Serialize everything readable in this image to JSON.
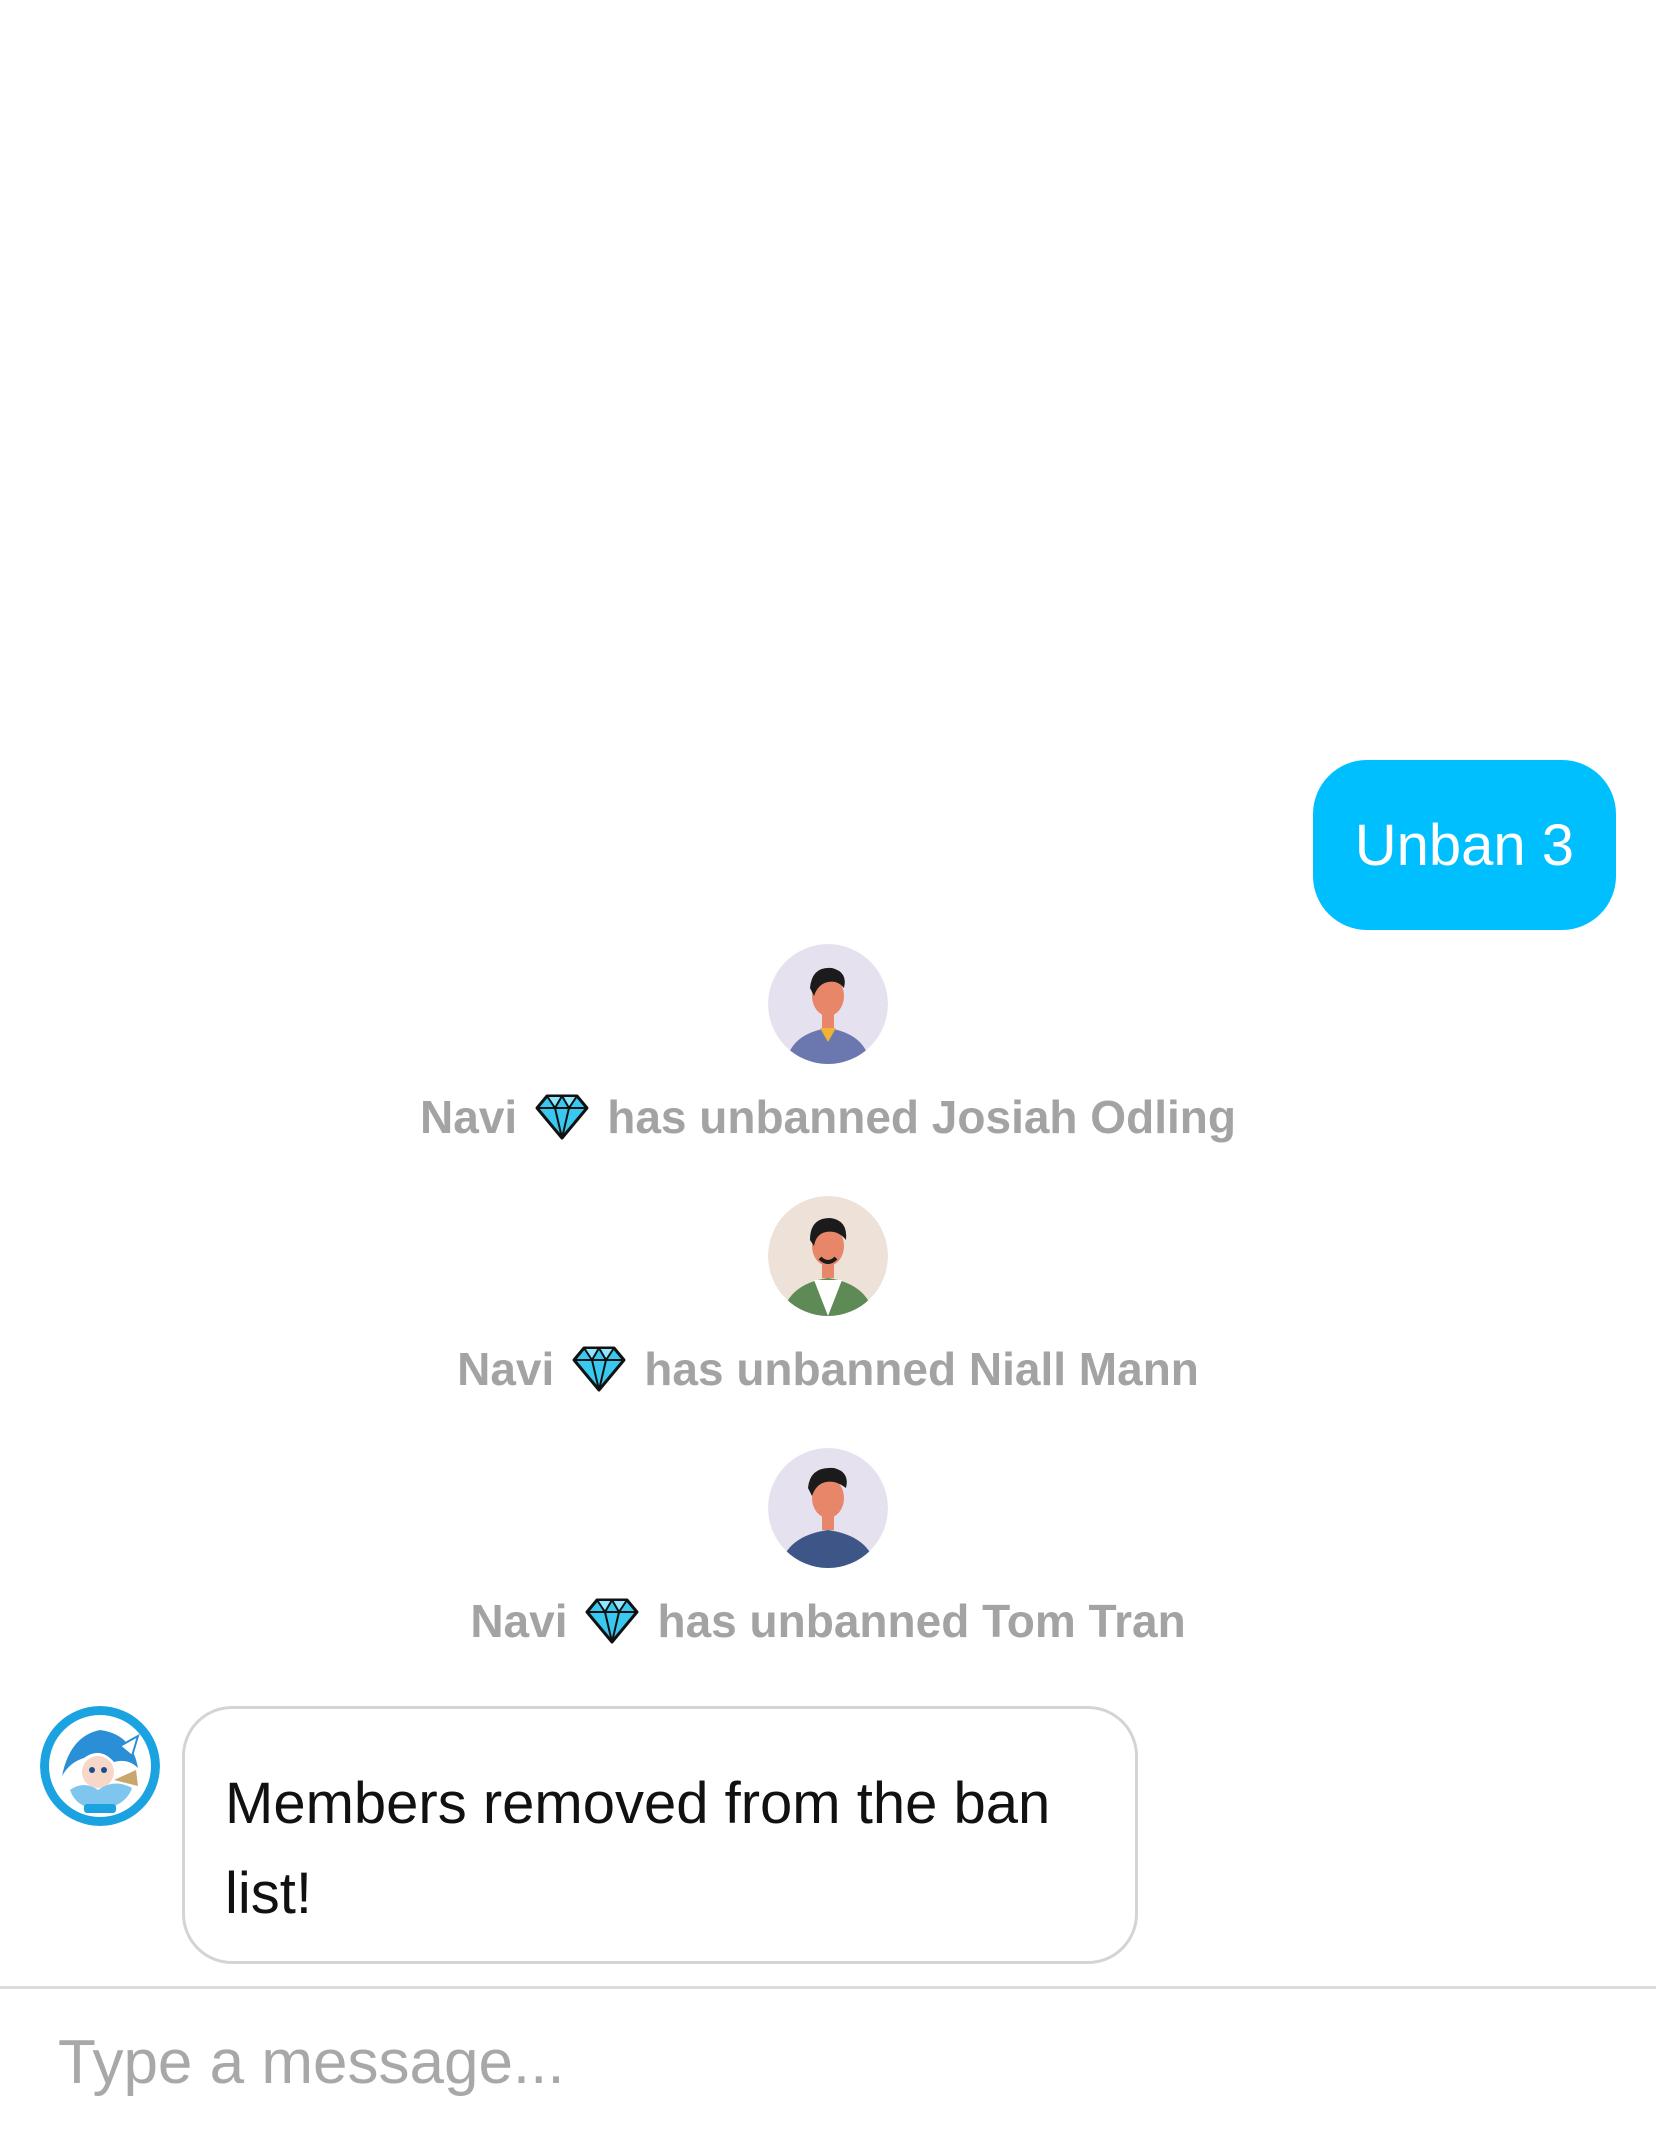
{
  "chat": {
    "outgoing_message": "Unban 3",
    "events": [
      {
        "actor": "Navi",
        "actor_badge_icon": "diamond-icon",
        "action": "has unbanned Josiah Odling",
        "avatar_icon": "user-avatar-josiah"
      },
      {
        "actor": "Navi",
        "actor_badge_icon": "diamond-icon",
        "action": "has unbanned Niall Mann",
        "avatar_icon": "user-avatar-niall"
      },
      {
        "actor": "Navi",
        "actor_badge_icon": "diamond-icon",
        "action": "has unbanned Tom Tran",
        "avatar_icon": "user-avatar-tom"
      }
    ],
    "bot_avatar_icon": "navi-bot-avatar",
    "bot_message": "Members removed from the ban list!"
  },
  "composer": {
    "placeholder": "Type a message..."
  },
  "colors": {
    "outgoing_bubble": "#00BFFF",
    "event_text": "#a3a3a3",
    "bot_avatar_ring": "#1aa3e0"
  }
}
